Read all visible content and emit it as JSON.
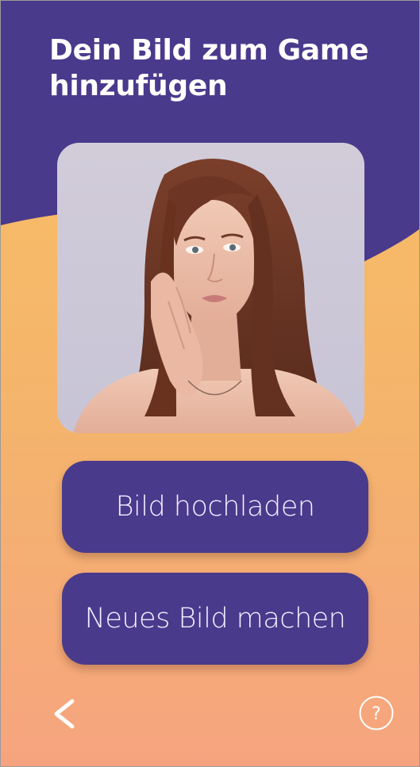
{
  "screen": {
    "title": "Dein Bild zum Game hinzufügen"
  },
  "photo": {
    "alt": "Porträt einer Frau mit schulterlangen braunen Haaren"
  },
  "actions": {
    "upload_label": "Bild hochladen",
    "camera_label": "Neues Bild machen"
  },
  "footer": {
    "back_icon": "chevron-left-icon",
    "help_icon": "question-circle-icon",
    "help_glyph": "?"
  },
  "colors": {
    "primary": "#4a3a8c",
    "gradient_top": "#f9c064",
    "gradient_bottom": "#f6a47f",
    "text_light": "#ffffff"
  }
}
